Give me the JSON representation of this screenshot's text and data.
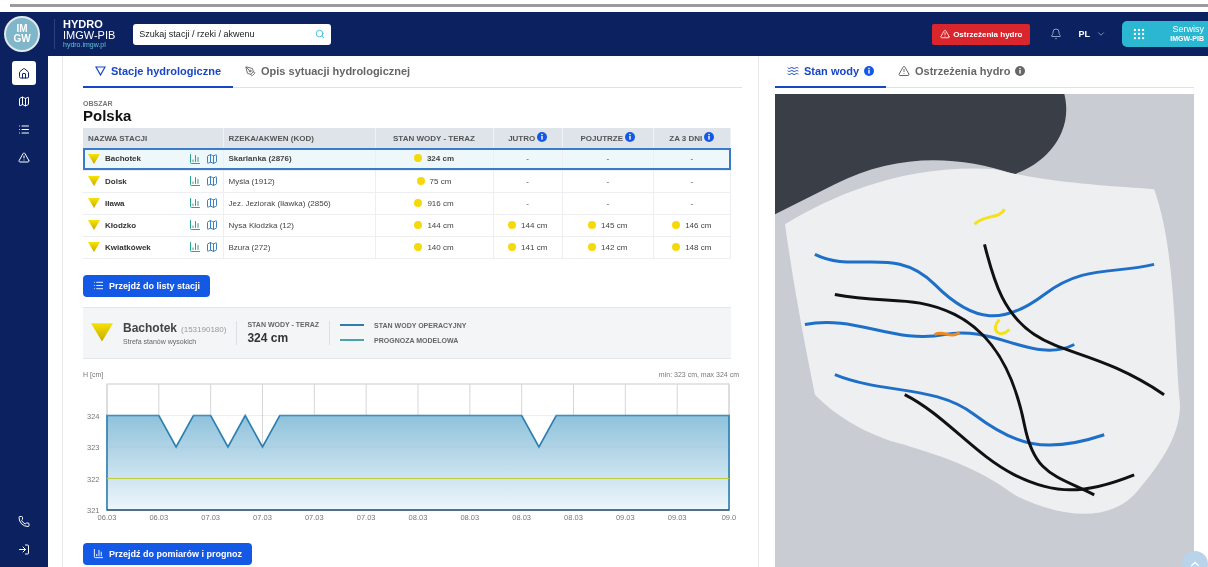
{
  "header": {
    "logo": {
      "line_1": "IM",
      "line_2": "GW"
    },
    "brand": {
      "title": "HYDRO",
      "subtitle": "IMGW-PIB",
      "url": "hydro.imgw.pl"
    },
    "search": {
      "placeholder": "Szukaj stacji / rzeki / akwenu"
    },
    "warnings_button": "Ostrzeżenia hydro",
    "language": "PL",
    "services_button": {
      "line_1": "Serwisy",
      "line_2": "IMGW-PIB"
    }
  },
  "sidebar": {
    "items": [
      {
        "selected": true
      },
      {
        "selected": false
      },
      {
        "selected": false
      },
      {
        "selected": false
      }
    ]
  },
  "left_tabs": [
    {
      "label": "Stacje hydrologiczne",
      "selected": true
    },
    {
      "label": "Opis sytuacji hydrologicznej",
      "selected": false
    }
  ],
  "area": {
    "label": "OBSZAR",
    "value": "Polska"
  },
  "table": {
    "columns": [
      {
        "label": "NAZWA STACJI",
        "info": false
      },
      {
        "label": "RZEKA/AKWEN (KOD)",
        "info": false
      },
      {
        "label": "STAN WODY - TERAZ",
        "info": false
      },
      {
        "label": "JUTRO",
        "info": true
      },
      {
        "label": "POJUTRZE",
        "info": true
      },
      {
        "label": "ZA 3 DNI",
        "info": true
      }
    ],
    "rows": [
      {
        "name": "Bachotek",
        "river": "Skarlanka (2876)",
        "selected": true,
        "now": {
          "kind": "reading",
          "text": "324 cm"
        },
        "forecast": [
          {
            "kind": "empty",
            "text": "-"
          },
          {
            "kind": "empty",
            "text": "-"
          },
          {
            "kind": "empty",
            "text": "-"
          }
        ]
      },
      {
        "name": "Dolsk",
        "river": "Myśla (1912)",
        "selected": false,
        "now": {
          "kind": "reading",
          "text": "75 cm"
        },
        "forecast": [
          {
            "kind": "empty",
            "text": "-"
          },
          {
            "kind": "empty",
            "text": "-"
          },
          {
            "kind": "empty",
            "text": "-"
          }
        ]
      },
      {
        "name": "Iława",
        "river": "Jez. Jeziorak (Iławka) (2856)",
        "selected": false,
        "now": {
          "kind": "reading",
          "text": "916 cm"
        },
        "forecast": [
          {
            "kind": "empty",
            "text": "-"
          },
          {
            "kind": "empty",
            "text": "-"
          },
          {
            "kind": "empty",
            "text": "-"
          }
        ]
      },
      {
        "name": "Kłodzko",
        "river": "Nysa Kłodzka (12)",
        "selected": false,
        "now": {
          "kind": "reading",
          "text": "144 cm"
        },
        "forecast": [
          {
            "kind": "reading",
            "text": "144 cm"
          },
          {
            "kind": "reading",
            "text": "145 cm"
          },
          {
            "kind": "reading",
            "text": "146 cm"
          }
        ]
      },
      {
        "name": "Kwiatkówek",
        "river": "Bzura (272)",
        "selected": false,
        "now": {
          "kind": "reading",
          "text": "140 cm"
        },
        "forecast": [
          {
            "kind": "reading",
            "text": "141 cm"
          },
          {
            "kind": "reading",
            "text": "142 cm"
          },
          {
            "kind": "reading",
            "text": "148 cm"
          }
        ]
      }
    ]
  },
  "list_button": "Przejdź do listy stacji",
  "station": {
    "name": "Bachotek",
    "code": "(153190180)",
    "zone": "Strefa stanów wysokich",
    "now_label": "STAN WODY - TERAZ",
    "now_value": "324 cm",
    "legend": [
      {
        "label": "STAN WODY OPERACYJNY",
        "color": "#2b7fb0"
      },
      {
        "label": "PROGNOZA MODELOWA",
        "color": "#4aa3a8"
      }
    ]
  },
  "chart": {
    "unit_label": "H [cm]",
    "range_label": "min: 323 cm, max 324 cm",
    "chart_data": {
      "type": "area",
      "categories": [
        "06.03",
        null,
        null,
        "06.03",
        null,
        null,
        "07.03",
        null,
        null,
        "07.03",
        null,
        null,
        "07.03",
        null,
        null,
        "07.03",
        null,
        null,
        "08.03",
        null,
        null,
        "08.03",
        null,
        null,
        "08.03",
        null,
        null,
        "08.03",
        null,
        null,
        "09.03",
        null,
        null,
        "09.03",
        null,
        null,
        "09.0"
      ],
      "grid": true,
      "series": [
        {
          "type": "area",
          "color": "#2b7fb0",
          "values": [
            324,
            324,
            324,
            324,
            323,
            324,
            324,
            323,
            324,
            323,
            324,
            324,
            324,
            324,
            324,
            324,
            324,
            324,
            324,
            324,
            324,
            324,
            324,
            324,
            324,
            323,
            324,
            324,
            324,
            324,
            324,
            324,
            324,
            324,
            324,
            324,
            324
          ]
        },
        {
          "type": "line",
          "color": "#c9d21a",
          "values": [
            322,
            322,
            322,
            322,
            322,
            322,
            322,
            322,
            322,
            322,
            322,
            322,
            322,
            322,
            322,
            322,
            322,
            322,
            322,
            322,
            322,
            322,
            322,
            322,
            322,
            322,
            322,
            322,
            322,
            322,
            322,
            322,
            322,
            322,
            322,
            322,
            322
          ]
        }
      ],
      "ylim": [
        321,
        325
      ],
      "yticks": [
        321,
        322,
        323,
        324
      ]
    }
  },
  "measure_button": "Przejdź do pomiarów i prognoz",
  "right_tabs": [
    {
      "label": "Stan wody",
      "selected": true
    },
    {
      "label": "Ostrzeżenia hydro",
      "selected": false
    }
  ]
}
